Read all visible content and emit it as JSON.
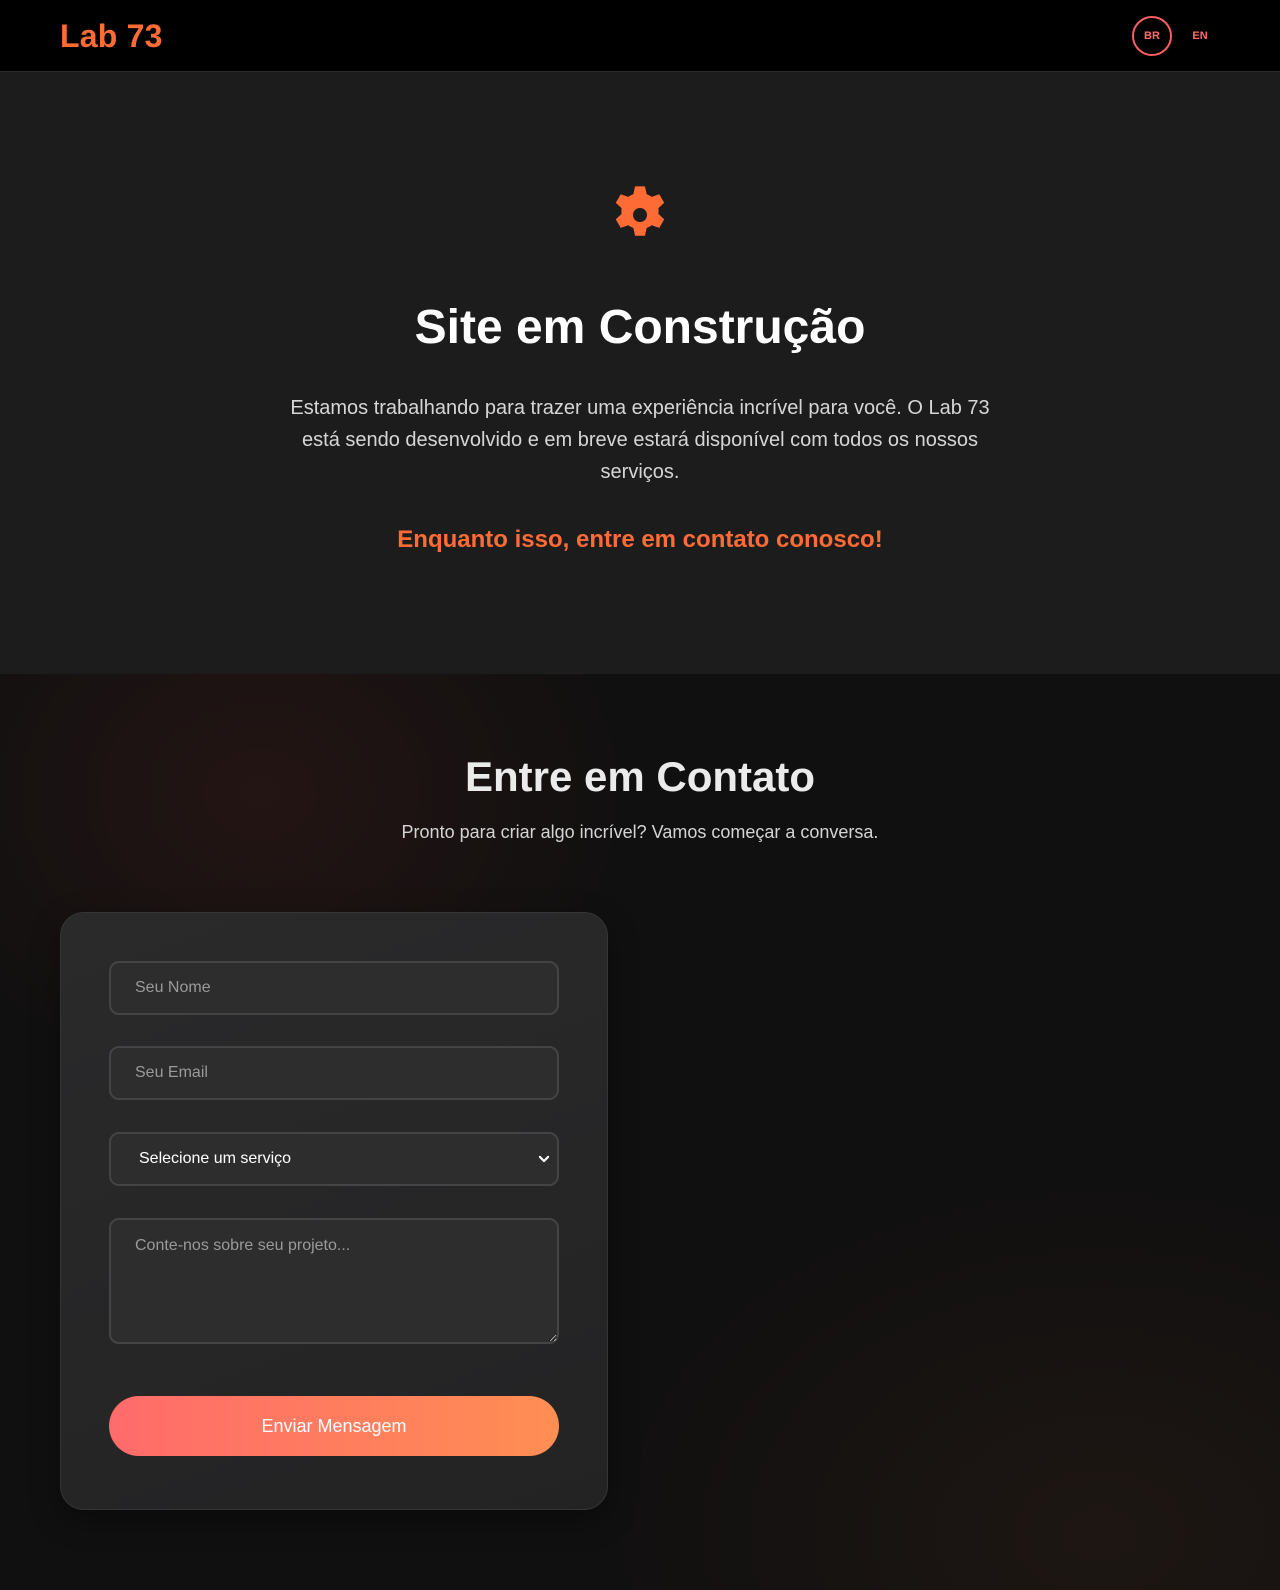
{
  "header": {
    "logo": "Lab 73",
    "lang_active": "BR",
    "lang_other": "EN"
  },
  "hero": {
    "icon": "gear-icon",
    "title": "Site em Construção",
    "text": "Estamos trabalhando para trazer uma experiência incrível para você. O Lab 73 está sendo desenvolvido e em breve estará disponível com todos os nossos serviços.",
    "cta": "Enquanto isso, entre em contato conosco!"
  },
  "contact": {
    "title": "Entre em Contato",
    "subtitle": "Pronto para criar algo incrível? Vamos começar a conversa.",
    "form": {
      "name_placeholder": "Seu Nome",
      "email_placeholder": "Seu Email",
      "service_selected": "Selecione um serviço",
      "message_placeholder": "Conte-nos sobre seu projeto...",
      "submit_label": "Enviar Mensagem"
    }
  },
  "colors": {
    "accent": "#ff6b35",
    "button_gradient_start": "#ff6b6b",
    "button_gradient_end": "#ff8e53",
    "header_bg": "#000000",
    "hero_bg": "#1c1c1d"
  }
}
